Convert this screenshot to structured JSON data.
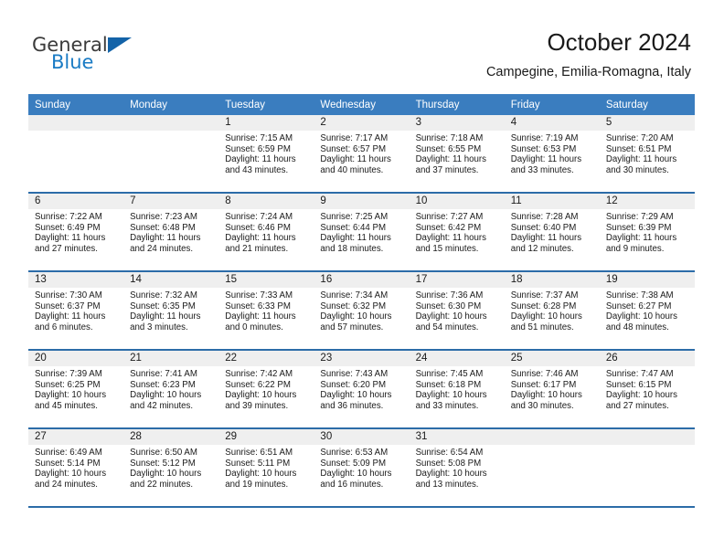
{
  "brand": {
    "name_part1": "General",
    "name_part2": "Blue"
  },
  "header": {
    "title": "October 2024",
    "subtitle": "Campegine, Emilia-Romagna, Italy"
  },
  "colors": {
    "header_row_bg": "#3a7dbf",
    "cell_border": "#2c6ca8",
    "daynum_bg": "#efefef",
    "brand_blue": "#1a7bc4"
  },
  "weekday_headers": [
    "Sunday",
    "Monday",
    "Tuesday",
    "Wednesday",
    "Thursday",
    "Friday",
    "Saturday"
  ],
  "weeks": [
    [
      {
        "day": "",
        "sunrise": "",
        "sunset": "",
        "daylight": "",
        "empty": true
      },
      {
        "day": "",
        "sunrise": "",
        "sunset": "",
        "daylight": "",
        "empty": true
      },
      {
        "day": "1",
        "sunrise": "Sunrise: 7:15 AM",
        "sunset": "Sunset: 6:59 PM",
        "daylight": "Daylight: 11 hours and 43 minutes."
      },
      {
        "day": "2",
        "sunrise": "Sunrise: 7:17 AM",
        "sunset": "Sunset: 6:57 PM",
        "daylight": "Daylight: 11 hours and 40 minutes."
      },
      {
        "day": "3",
        "sunrise": "Sunrise: 7:18 AM",
        "sunset": "Sunset: 6:55 PM",
        "daylight": "Daylight: 11 hours and 37 minutes."
      },
      {
        "day": "4",
        "sunrise": "Sunrise: 7:19 AM",
        "sunset": "Sunset: 6:53 PM",
        "daylight": "Daylight: 11 hours and 33 minutes."
      },
      {
        "day": "5",
        "sunrise": "Sunrise: 7:20 AM",
        "sunset": "Sunset: 6:51 PM",
        "daylight": "Daylight: 11 hours and 30 minutes."
      }
    ],
    [
      {
        "day": "6",
        "sunrise": "Sunrise: 7:22 AM",
        "sunset": "Sunset: 6:49 PM",
        "daylight": "Daylight: 11 hours and 27 minutes."
      },
      {
        "day": "7",
        "sunrise": "Sunrise: 7:23 AM",
        "sunset": "Sunset: 6:48 PM",
        "daylight": "Daylight: 11 hours and 24 minutes."
      },
      {
        "day": "8",
        "sunrise": "Sunrise: 7:24 AM",
        "sunset": "Sunset: 6:46 PM",
        "daylight": "Daylight: 11 hours and 21 minutes."
      },
      {
        "day": "9",
        "sunrise": "Sunrise: 7:25 AM",
        "sunset": "Sunset: 6:44 PM",
        "daylight": "Daylight: 11 hours and 18 minutes."
      },
      {
        "day": "10",
        "sunrise": "Sunrise: 7:27 AM",
        "sunset": "Sunset: 6:42 PM",
        "daylight": "Daylight: 11 hours and 15 minutes."
      },
      {
        "day": "11",
        "sunrise": "Sunrise: 7:28 AM",
        "sunset": "Sunset: 6:40 PM",
        "daylight": "Daylight: 11 hours and 12 minutes."
      },
      {
        "day": "12",
        "sunrise": "Sunrise: 7:29 AM",
        "sunset": "Sunset: 6:39 PM",
        "daylight": "Daylight: 11 hours and 9 minutes."
      }
    ],
    [
      {
        "day": "13",
        "sunrise": "Sunrise: 7:30 AM",
        "sunset": "Sunset: 6:37 PM",
        "daylight": "Daylight: 11 hours and 6 minutes."
      },
      {
        "day": "14",
        "sunrise": "Sunrise: 7:32 AM",
        "sunset": "Sunset: 6:35 PM",
        "daylight": "Daylight: 11 hours and 3 minutes."
      },
      {
        "day": "15",
        "sunrise": "Sunrise: 7:33 AM",
        "sunset": "Sunset: 6:33 PM",
        "daylight": "Daylight: 11 hours and 0 minutes."
      },
      {
        "day": "16",
        "sunrise": "Sunrise: 7:34 AM",
        "sunset": "Sunset: 6:32 PM",
        "daylight": "Daylight: 10 hours and 57 minutes."
      },
      {
        "day": "17",
        "sunrise": "Sunrise: 7:36 AM",
        "sunset": "Sunset: 6:30 PM",
        "daylight": "Daylight: 10 hours and 54 minutes."
      },
      {
        "day": "18",
        "sunrise": "Sunrise: 7:37 AM",
        "sunset": "Sunset: 6:28 PM",
        "daylight": "Daylight: 10 hours and 51 minutes."
      },
      {
        "day": "19",
        "sunrise": "Sunrise: 7:38 AM",
        "sunset": "Sunset: 6:27 PM",
        "daylight": "Daylight: 10 hours and 48 minutes."
      }
    ],
    [
      {
        "day": "20",
        "sunrise": "Sunrise: 7:39 AM",
        "sunset": "Sunset: 6:25 PM",
        "daylight": "Daylight: 10 hours and 45 minutes."
      },
      {
        "day": "21",
        "sunrise": "Sunrise: 7:41 AM",
        "sunset": "Sunset: 6:23 PM",
        "daylight": "Daylight: 10 hours and 42 minutes."
      },
      {
        "day": "22",
        "sunrise": "Sunrise: 7:42 AM",
        "sunset": "Sunset: 6:22 PM",
        "daylight": "Daylight: 10 hours and 39 minutes."
      },
      {
        "day": "23",
        "sunrise": "Sunrise: 7:43 AM",
        "sunset": "Sunset: 6:20 PM",
        "daylight": "Daylight: 10 hours and 36 minutes."
      },
      {
        "day": "24",
        "sunrise": "Sunrise: 7:45 AM",
        "sunset": "Sunset: 6:18 PM",
        "daylight": "Daylight: 10 hours and 33 minutes."
      },
      {
        "day": "25",
        "sunrise": "Sunrise: 7:46 AM",
        "sunset": "Sunset: 6:17 PM",
        "daylight": "Daylight: 10 hours and 30 minutes."
      },
      {
        "day": "26",
        "sunrise": "Sunrise: 7:47 AM",
        "sunset": "Sunset: 6:15 PM",
        "daylight": "Daylight: 10 hours and 27 minutes."
      }
    ],
    [
      {
        "day": "27",
        "sunrise": "Sunrise: 6:49 AM",
        "sunset": "Sunset: 5:14 PM",
        "daylight": "Daylight: 10 hours and 24 minutes."
      },
      {
        "day": "28",
        "sunrise": "Sunrise: 6:50 AM",
        "sunset": "Sunset: 5:12 PM",
        "daylight": "Daylight: 10 hours and 22 minutes."
      },
      {
        "day": "29",
        "sunrise": "Sunrise: 6:51 AM",
        "sunset": "Sunset: 5:11 PM",
        "daylight": "Daylight: 10 hours and 19 minutes."
      },
      {
        "day": "30",
        "sunrise": "Sunrise: 6:53 AM",
        "sunset": "Sunset: 5:09 PM",
        "daylight": "Daylight: 10 hours and 16 minutes."
      },
      {
        "day": "31",
        "sunrise": "Sunrise: 6:54 AM",
        "sunset": "Sunset: 5:08 PM",
        "daylight": "Daylight: 10 hours and 13 minutes."
      },
      {
        "day": "",
        "sunrise": "",
        "sunset": "",
        "daylight": "",
        "empty": true
      },
      {
        "day": "",
        "sunrise": "",
        "sunset": "",
        "daylight": "",
        "empty": true
      }
    ]
  ]
}
